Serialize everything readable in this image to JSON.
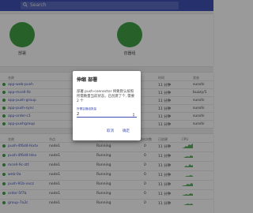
{
  "topbar": {
    "search_placeholder": "Search"
  },
  "status_card": {
    "charts": [
      {
        "label": "部署",
        "color": "#43a047"
      },
      {
        "label": "容器组",
        "color": "#43a047"
      }
    ]
  },
  "list1": {
    "columns": [
      "名称",
      "年龄",
      "",
      "时间",
      "状态"
    ],
    "rows": [
      {
        "name": "app-web-push",
        "age": "11 分钟",
        "extra": "sunshi"
      },
      {
        "name": "app-mcell-9c",
        "age": "11 分钟",
        "extra": "buzzy/1"
      },
      {
        "name": "app-push-group",
        "age": "11 分钟",
        "extra": "sunshi"
      },
      {
        "name": "app-push-sync",
        "age": "11 分钟",
        "extra": "sunshi"
      },
      {
        "name": "app-order-c1",
        "age": "11 分钟",
        "extra": "sunshi"
      },
      {
        "name": "app-pushgroup",
        "age": "11 分钟",
        "extra": "sunshi"
      }
    ]
  },
  "list2": {
    "columns": [
      "名称",
      "节点",
      "状态",
      "重启次数",
      "已创建",
      "CPU"
    ],
    "rows": [
      {
        "name": "push-4f6d4-lkxtv",
        "node": "node1",
        "status": "Running",
        "restarts": "0",
        "age": "11 分钟"
      },
      {
        "name": "push-4f6d4-ldsv",
        "node": "node1",
        "status": "Running",
        "restarts": "0",
        "age": "11 分钟"
      },
      {
        "name": "mcell-9c-ztt",
        "node": "node1",
        "status": "Running",
        "restarts": "0",
        "age": "11 分钟"
      },
      {
        "name": "web-0a",
        "node": "node1",
        "status": "Running",
        "restarts": "0",
        "age": "11 分钟"
      },
      {
        "name": "push-91b-xxcz",
        "node": "node1",
        "status": "Running",
        "restarts": "0",
        "age": "11 分钟"
      },
      {
        "name": "order-5f7b",
        "node": "node1",
        "status": "Running",
        "restarts": "0",
        "age": "11 分钟"
      },
      {
        "name": "group-7a2c",
        "node": "node1",
        "status": "Running",
        "restarts": "0",
        "age": "11 分钟"
      }
    ]
  },
  "dialog": {
    "title": "伸缩 部署",
    "message": "部署 push-connector 将要默认按照所需数量当前状态，已创建了个, 需要 2 个",
    "field_label": "所需容器组数量",
    "value": "2",
    "cancel_label": "取消",
    "ok_label": "确定"
  }
}
